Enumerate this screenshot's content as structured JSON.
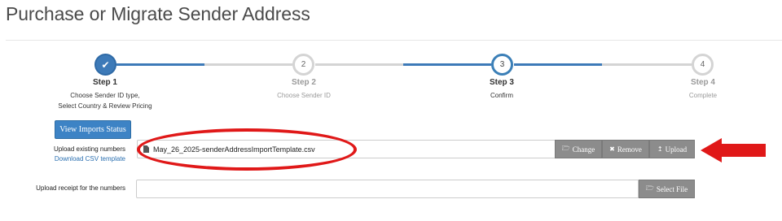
{
  "page": {
    "title": "Purchase or Migrate Sender Address"
  },
  "stepper": {
    "steps": [
      {
        "number": "",
        "label": "Step 1",
        "desc_line1": "Choose Sender ID type,",
        "desc_line2": "Select Country & Review Pricing",
        "state": "done",
        "icon": "check-icon"
      },
      {
        "number": "2",
        "label": "Step 2",
        "desc_line1": "Choose Sender ID",
        "desc_line2": "",
        "state": "pending"
      },
      {
        "number": "3",
        "label": "Step 3",
        "desc_line1": "Confirm",
        "desc_line2": "",
        "state": "active"
      },
      {
        "number": "4",
        "label": "Step 4",
        "desc_line1": "Complete",
        "desc_line2": "",
        "state": "pending"
      }
    ],
    "colors": {
      "complete": "#3d7ab8",
      "pending": "#d4d4d4"
    }
  },
  "imports": {
    "view_button": "View Imports Status"
  },
  "upload": {
    "label": "Upload existing numbers",
    "download_link": "Download CSV template",
    "filename": "May_26_2025-senderAddressImportTemplate.csv",
    "change_label": "Change",
    "remove_label": "Remove",
    "upload_label": "Upload"
  },
  "receipt": {
    "label": "Upload receipt for the numbers",
    "value": "",
    "select_label": "Select File"
  },
  "annotations": {
    "highlight_color": "#e01818",
    "arrow_color": "#e01818"
  }
}
